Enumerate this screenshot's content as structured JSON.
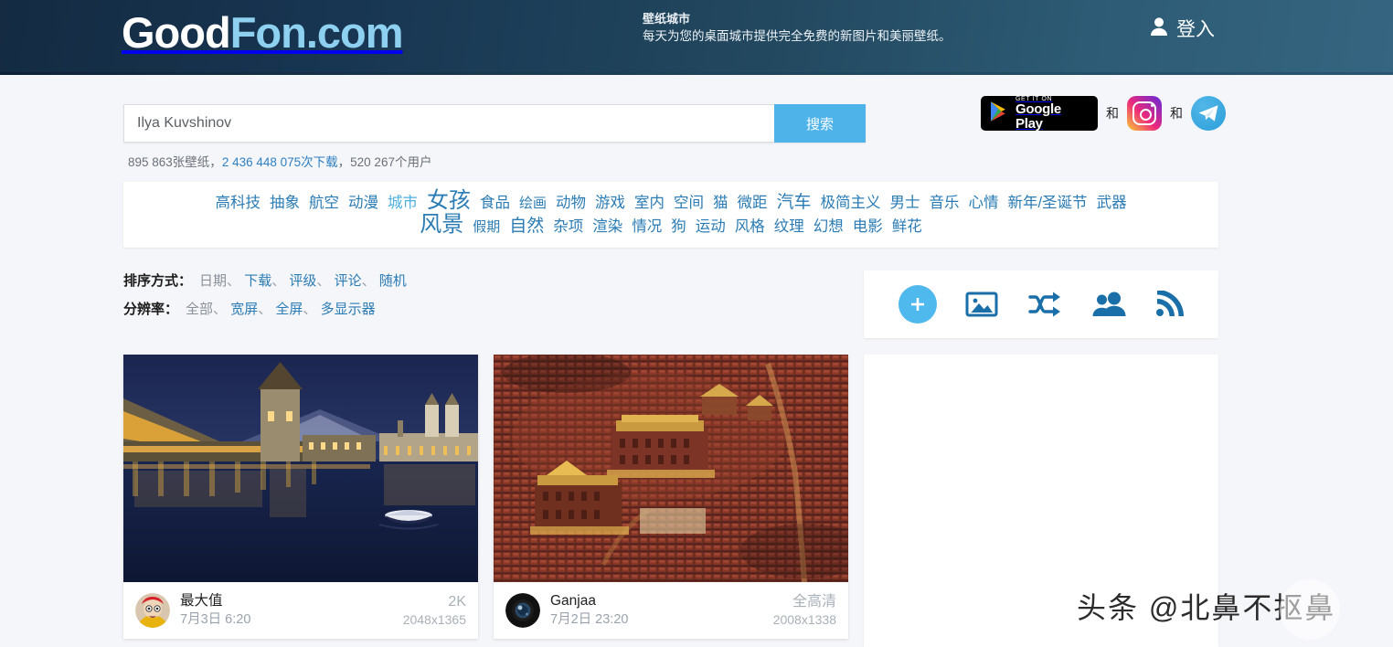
{
  "header": {
    "logo_first": "Good",
    "logo_second": "Fon.com",
    "tagline_title": "壁纸城市",
    "tagline_sub": "每天为您的桌面城市提供完全免费的新图片和美丽壁纸。",
    "login_label": "登入",
    "login_icon": "person-icon",
    "bg_left": "#142b42",
    "bg_right": "#356580"
  },
  "search": {
    "placeholder": "Ilya Kuvshinov",
    "value": "",
    "button_label": "搜索",
    "button_color": "#4eb3e8",
    "stats_wallpapers": "895 863张壁纸，",
    "stats_downloads": "2 436 448 075次下载",
    "stats_users": "，520 267个用户"
  },
  "promo": {
    "google_play_small": "GET IT ON",
    "google_play_big": "Google Play",
    "and_1": "和",
    "and_2": "和",
    "instagram_icon": "instagram-icon",
    "telegram_icon": "telegram-icon"
  },
  "tags": {
    "row1": [
      {
        "label": "高科技",
        "size": "s16"
      },
      {
        "label": "抽象",
        "size": "s16"
      },
      {
        "label": "航空",
        "size": "s16"
      },
      {
        "label": "动漫",
        "size": "s16"
      },
      {
        "label": "城市",
        "size": "s16",
        "highlight": true
      },
      {
        "label": "女孩",
        "size": "s24"
      },
      {
        "label": "食品",
        "size": "s16"
      },
      {
        "label": "绘画",
        "size": "s14"
      },
      {
        "label": "动物",
        "size": "s16"
      },
      {
        "label": "游戏",
        "size": "s16"
      },
      {
        "label": "室内",
        "size": "s16"
      },
      {
        "label": "空间",
        "size": "s16"
      },
      {
        "label": "猫",
        "size": "s16"
      },
      {
        "label": "微距",
        "size": "s16"
      },
      {
        "label": "汽车",
        "size": "s19"
      },
      {
        "label": "极简主义",
        "size": "s16"
      },
      {
        "label": "男士",
        "size": "s16"
      },
      {
        "label": "音乐",
        "size": "s16"
      },
      {
        "label": "心情",
        "size": "s16"
      },
      {
        "label": "新年/圣诞节",
        "size": "s16"
      },
      {
        "label": "武器",
        "size": "s16"
      }
    ],
    "row2": [
      {
        "label": "风景",
        "size": "s24"
      },
      {
        "label": "假期",
        "size": "s14"
      },
      {
        "label": "自然",
        "size": "s19"
      },
      {
        "label": "杂项",
        "size": "s16"
      },
      {
        "label": "渲染",
        "size": "s16"
      },
      {
        "label": "情况",
        "size": "s16"
      },
      {
        "label": "狗",
        "size": "s16"
      },
      {
        "label": "运动",
        "size": "s16"
      },
      {
        "label": "风格",
        "size": "s16"
      },
      {
        "label": "纹理",
        "size": "s16"
      },
      {
        "label": "幻想",
        "size": "s16"
      },
      {
        "label": "电影",
        "size": "s16"
      },
      {
        "label": "鲜花",
        "size": "s16"
      }
    ]
  },
  "filters": {
    "sort_label": "排序方式：",
    "sort_options": [
      "日期",
      "下载",
      "评级",
      "评论",
      "随机"
    ],
    "sort_active": "日期",
    "res_label": "分辨率：",
    "res_options": [
      "全部",
      "宽屏",
      "全屏",
      "多显示器"
    ],
    "res_active": "全部",
    "separator": "、"
  },
  "actionbar": {
    "items": [
      {
        "icon": "plus-icon",
        "name": "add-button"
      },
      {
        "icon": "image-icon",
        "name": "gallery-button"
      },
      {
        "icon": "shuffle-icon",
        "name": "random-button"
      },
      {
        "icon": "users-icon",
        "name": "users-button"
      },
      {
        "icon": "rss-icon",
        "name": "rss-button"
      }
    ],
    "accent": "#4fb8ec",
    "icon_color": "#1a6fa8"
  },
  "cards": [
    {
      "author": "最大值",
      "date": "7月3日 6:20",
      "quality": "2K",
      "resolution": "2048x1365",
      "image_alt": "夜景中的卢塞恩廊桥与水中倒影"
    },
    {
      "author": "Ganjaa",
      "date": "7月2日 23:20",
      "quality": "全高清",
      "resolution": "2008x1338",
      "image_alt": "喇荣五明佛学院红色木屋航拍"
    }
  ],
  "watermark": {
    "text": "头条 @北鼻不抠鼻"
  }
}
